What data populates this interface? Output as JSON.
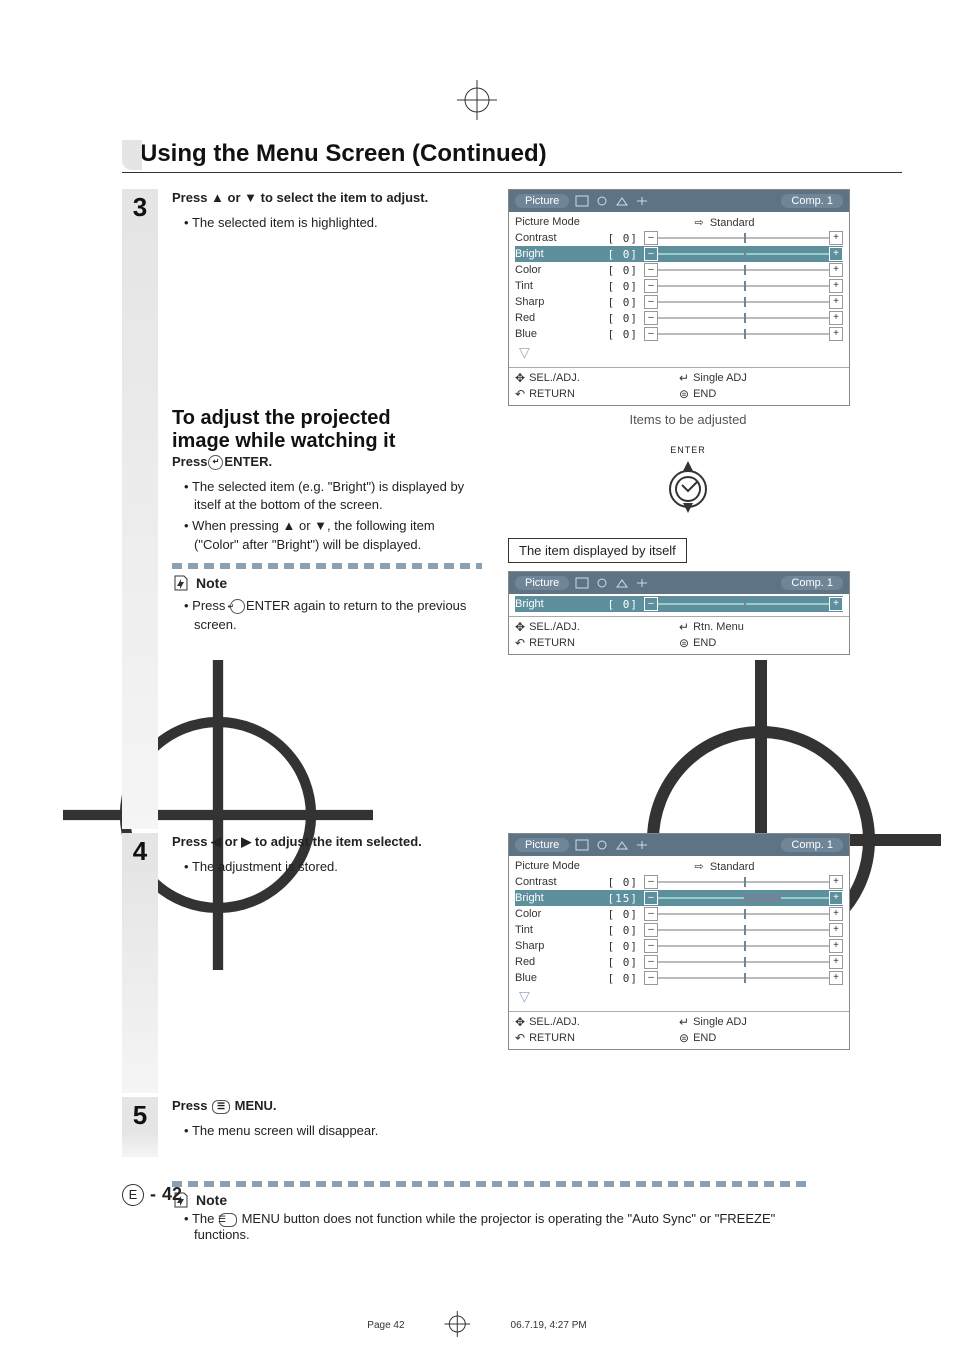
{
  "page": {
    "title": "Using the Menu Screen (Continued)",
    "page_number_prefix": "E",
    "page_number": "42",
    "print_page": "Page 42",
    "print_date": "06.7.19, 4:27 PM"
  },
  "steps": {
    "s3": {
      "num": "3",
      "head_a": "Press ",
      "head_b": " or ",
      "head_c": " to select the item to adjust.",
      "bullet1": "The selected item is highlighted."
    },
    "adjust_section": {
      "title_line1": "To adjust the projected",
      "title_line2": "image while watching it",
      "press_label_a": "Press",
      "press_label_b": "ENTER.",
      "b1": "The selected item (e.g. \"Bright\") is displayed by itself at the bottom of the screen.",
      "b2_a": "When pressing ",
      "b2_b": " or ",
      "b2_c": ", the following item (\"Color\" after \"Bright\") will be displayed."
    },
    "note3": {
      "label": "Note",
      "b1_a": "Press ",
      "b1_b": "ENTER again to return to the previous screen."
    },
    "s4": {
      "num": "4",
      "head_a": "Press ",
      "head_b": " or ",
      "head_c": " to adjust the item selected.",
      "bullet1": "The adjustment is stored."
    },
    "s5": {
      "num": "5",
      "head_a": "Press ",
      "head_b": " MENU.",
      "bullet1": "The menu screen will disappear."
    }
  },
  "bottom_note": {
    "label": "Note",
    "b1_a": "The ",
    "b1_b": "MENU button does not function while the projector is operating the \"Auto Sync\" or \"FREEZE\" functions."
  },
  "osd_common": {
    "tab": "Picture",
    "rtitle": "Comp. 1",
    "mode_label": "Picture Mode",
    "mode_value": "Standard",
    "rows": [
      {
        "label": "Contrast",
        "value": "0"
      },
      {
        "label": "Bright",
        "value": "0"
      },
      {
        "label": "Color",
        "value": "0"
      },
      {
        "label": "Tint",
        "value": "0"
      },
      {
        "label": "Sharp",
        "value": "0"
      },
      {
        "label": "Red",
        "value": "0"
      },
      {
        "label": "Blue",
        "value": "0"
      }
    ],
    "foot_sel": "SEL./ADJ.",
    "foot_single": "Single ADJ",
    "foot_return": "RETURN",
    "foot_end": "END",
    "caption_items": "Items to be adjusted",
    "enter_label": "ENTER"
  },
  "osd_single": {
    "box_label": "The item displayed by itself",
    "row_label": "Bright",
    "row_value": "0",
    "foot_rtn": "Rtn. Menu"
  },
  "osd_after": {
    "bright_value": "15"
  }
}
